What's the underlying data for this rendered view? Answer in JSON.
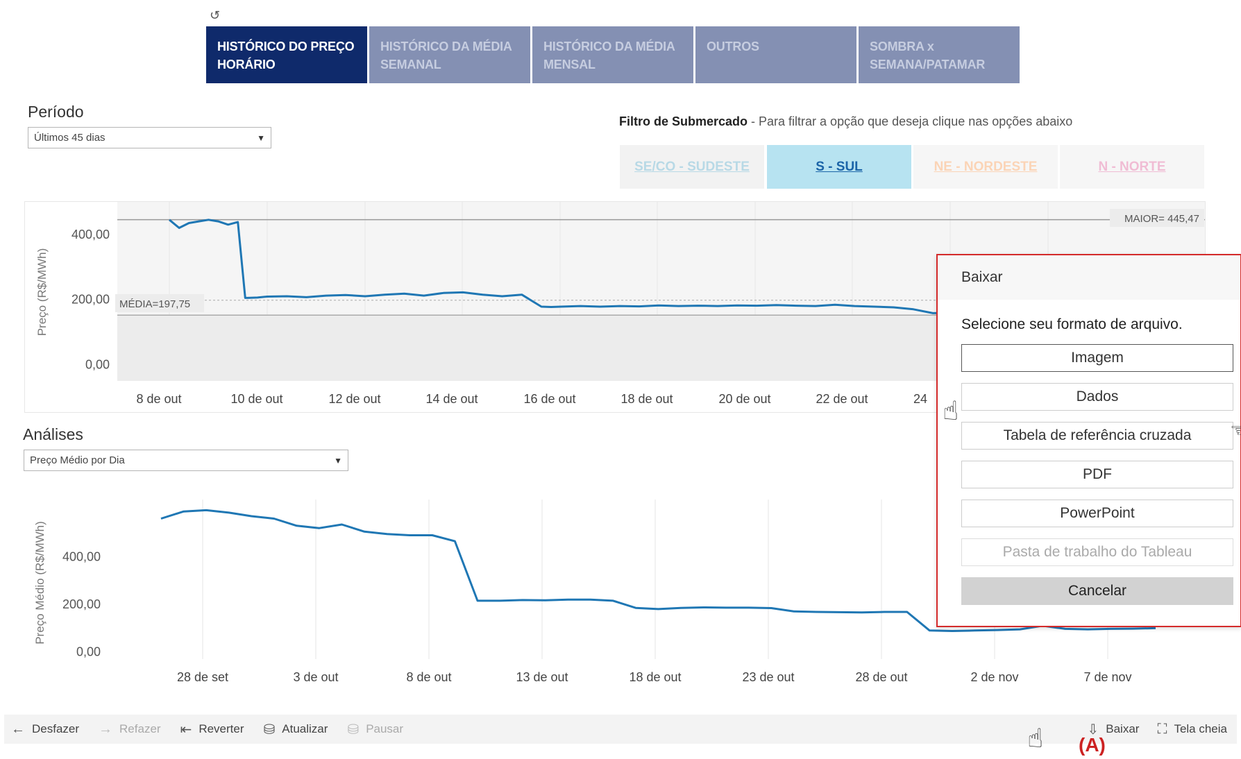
{
  "tabs": [
    {
      "line1": "HISTÓRICO DO PREÇO",
      "line2": "HORÁRIO"
    },
    {
      "line1": "HISTÓRICO DA MÉDIA",
      "line2": "SEMANAL"
    },
    {
      "line1": "HISTÓRICO DA MÉDIA",
      "line2": "MENSAL"
    },
    {
      "line1": "OUTROS",
      "line2": ""
    },
    {
      "line1": "SOMBRA x",
      "line2": "SEMANA/PATAMAR"
    }
  ],
  "periodo": {
    "label": "Período",
    "value": "Últimos 45 dias"
  },
  "filtro": {
    "bold": "Filtro de Submercado",
    "rest": " - Para filtrar a opção que deseja clique nas opções abaixo"
  },
  "submercados": [
    "SE/CO - SUDESTE",
    "S - SUL",
    "NE - NORDESTE",
    "N - NORTE"
  ],
  "analises": {
    "label": "Análises",
    "value": "Preço Médio por Dia"
  },
  "chart_data": [
    {
      "type": "line",
      "ylabel": "Preço (R$/MWh)",
      "yticks": [
        "400,00",
        "200,00",
        "0,00"
      ],
      "ylim": [
        -50,
        500
      ],
      "xticks": [
        "8 de out",
        "10 de out",
        "12 de out",
        "14 de out",
        "16 de out",
        "18 de out",
        "20 de out",
        "22 de out",
        "24"
      ],
      "annotations": {
        "maior": "MAIOR= 445,47",
        "media": "MÉDIA=197,75"
      },
      "reference_lines": {
        "maior": 445.47,
        "media": 197.75,
        "band_low": 152
      },
      "x": [
        0,
        0.2,
        0.4,
        0.6,
        0.8,
        1.0,
        1.2,
        1.4,
        1.55,
        1.6,
        1.8,
        2.0,
        2.4,
        2.8,
        3.2,
        3.6,
        4.0,
        4.4,
        4.8,
        5.2,
        5.6,
        6.0,
        6.4,
        6.8,
        7.2,
        7.6,
        7.8,
        8.0,
        8.4,
        8.8,
        9.2,
        9.6,
        10.0,
        10.4,
        10.8,
        11.2,
        11.6,
        12.0,
        12.4,
        12.8,
        13.2,
        13.6,
        14.0,
        14.4,
        14.8,
        15.2,
        15.6,
        15.8,
        16.0,
        16.4,
        16.8
      ],
      "values": [
        445,
        420,
        435,
        440,
        445,
        440,
        430,
        438,
        205,
        205,
        206,
        209,
        210,
        207,
        212,
        214,
        210,
        215,
        218,
        212,
        220,
        222,
        215,
        210,
        215,
        178,
        177,
        178,
        180,
        178,
        180,
        179,
        182,
        180,
        181,
        180,
        182,
        181,
        183,
        181,
        180,
        184,
        180,
        178,
        176,
        170,
        158,
        159,
        160,
        162,
        163
      ]
    },
    {
      "type": "line",
      "ylabel": "Preço Médio (R$/MWh)",
      "yticks": [
        "400,00",
        "200,00",
        "0,00"
      ],
      "ylim": [
        -30,
        640
      ],
      "xticks": [
        "28 de set",
        "3 de out",
        "8 de out",
        "13 de out",
        "18 de out",
        "23 de out",
        "28 de out",
        "2 de nov",
        "7 de nov"
      ],
      "x": [
        -2,
        -1,
        0,
        1,
        2,
        3,
        4,
        5,
        6,
        7,
        8,
        9,
        10,
        11,
        12,
        13,
        14,
        15,
        16,
        17,
        18,
        19,
        20,
        21,
        22,
        23,
        24,
        25,
        26,
        27,
        28,
        29,
        30,
        31,
        32,
        33,
        34,
        35,
        36,
        37,
        38,
        39,
        40,
        41,
        42
      ],
      "values": [
        560,
        590,
        595,
        585,
        570,
        560,
        530,
        520,
        535,
        505,
        495,
        490,
        490,
        465,
        215,
        215,
        218,
        217,
        220,
        220,
        215,
        185,
        180,
        185,
        187,
        186,
        186,
        184,
        170,
        168,
        167,
        166,
        168,
        168,
        90,
        88,
        90,
        92,
        95,
        110,
        97,
        95,
        97,
        98,
        100
      ]
    }
  ],
  "toolbar": {
    "undo": "Desfazer",
    "redo": "Refazer",
    "revert": "Reverter",
    "refresh": "Atualizar",
    "pause": "Pausar",
    "download": "Baixar",
    "fullscreen": "Tela cheia"
  },
  "dialog": {
    "title": "Baixar",
    "subtitle": "Selecione seu formato de arquivo.",
    "options": [
      "Imagem",
      "Dados",
      "Tabela de referência cruzada",
      "PDF",
      "PowerPoint",
      "Pasta de trabalho do Tableau"
    ],
    "cancel": "Cancelar"
  },
  "annotation_label": "(A)"
}
